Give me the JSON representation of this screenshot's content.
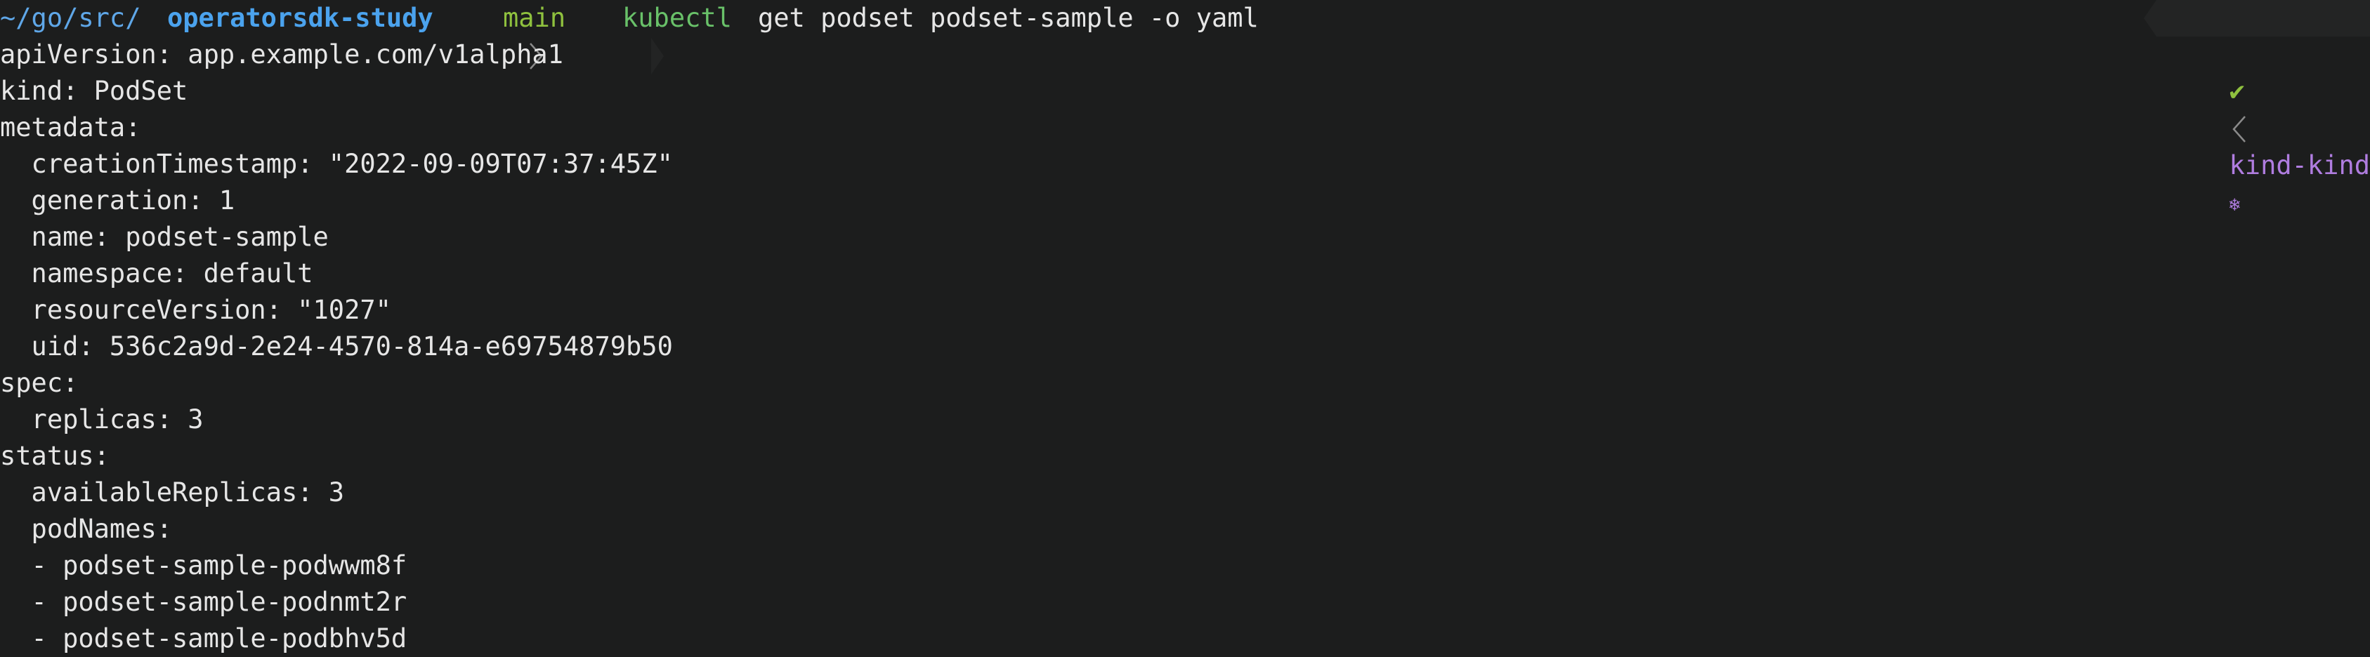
{
  "prompt": {
    "path_prefix": "~/go/src/",
    "path_current": "operatorsdk-study",
    "branch": "main",
    "command": "kubectl",
    "command_args": "get podset podset-sample -o yaml",
    "status_check": "✔",
    "context": "kind-kind",
    "kube_icon": "❄",
    "colors": {
      "background": "#1c1d1d",
      "path": "#4ba3ee",
      "branch": "#8fc13e",
      "command": "#69c169",
      "context": "#b07de0"
    }
  },
  "output": {
    "lines": [
      "apiVersion: app.example.com/v1alpha1",
      "kind: PodSet",
      "metadata:",
      "  creationTimestamp: \"2022-09-09T07:37:45Z\"",
      "  generation: 1",
      "  name: podset-sample",
      "  namespace: default",
      "  resourceVersion: \"1027\"",
      "  uid: 536c2a9d-2e24-4570-814a-e69754879b50",
      "spec:",
      "  replicas: 3",
      "status:",
      "  availableReplicas: 3",
      "  podNames:",
      "  - podset-sample-podwwm8f",
      "  - podset-sample-podnmt2r",
      "  - podset-sample-podbhv5d"
    ]
  }
}
